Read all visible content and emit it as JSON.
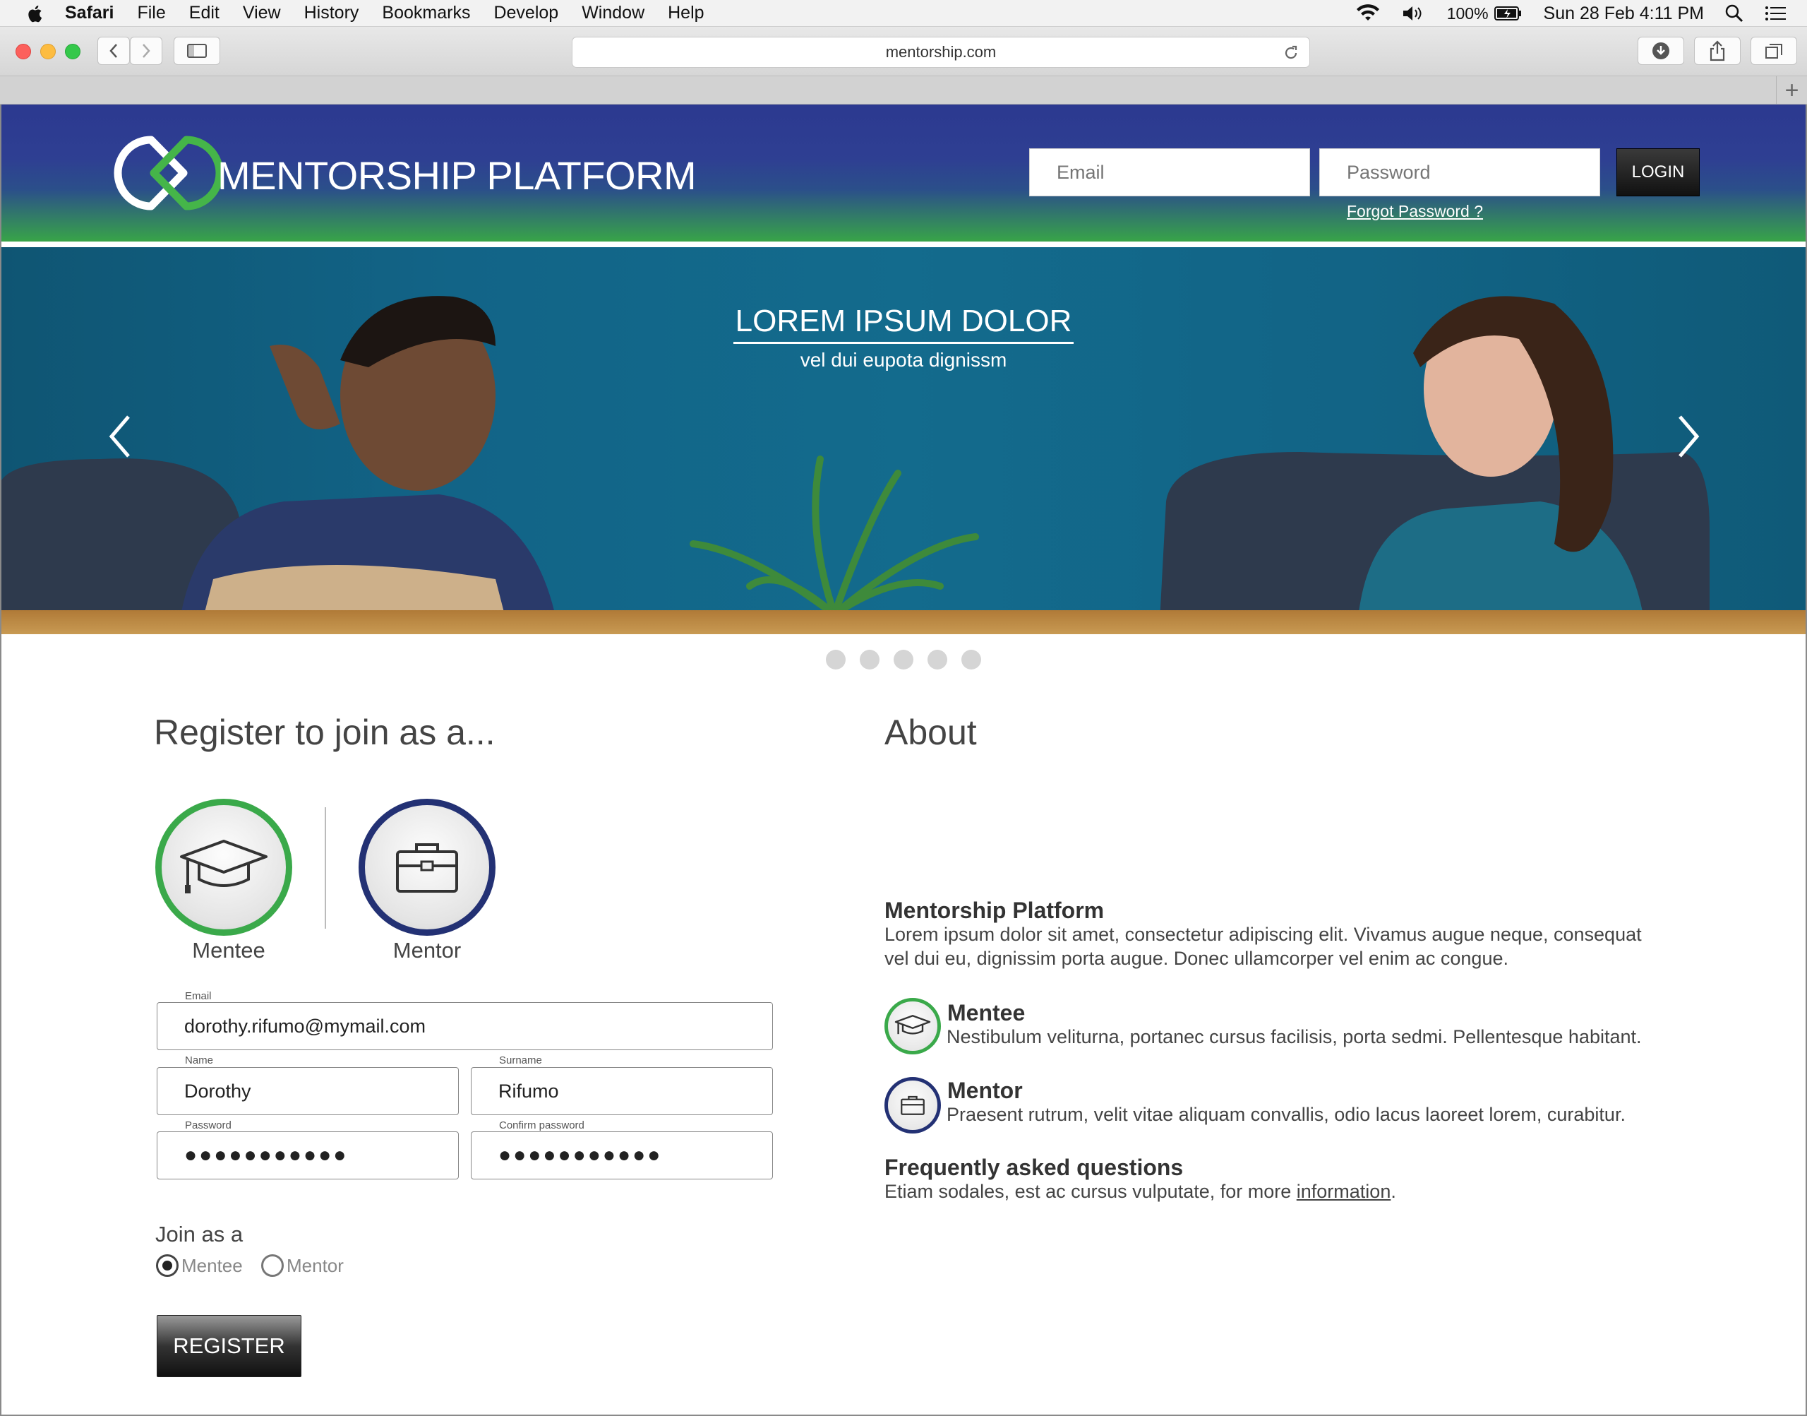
{
  "menubar": {
    "app": "Safari",
    "items": [
      "File",
      "Edit",
      "View",
      "History",
      "Bookmarks",
      "Develop",
      "Window",
      "Help"
    ],
    "battery": "100%",
    "clock": "Sun 28 Feb  4:11 PM"
  },
  "browser": {
    "url": "mentorship.com",
    "new_tab": "+"
  },
  "header": {
    "brand": "MENTORSHIP PLATFORM",
    "email_placeholder": "Email",
    "password_placeholder": "Password",
    "login_label": "LOGIN",
    "forgot_label": "Forgot Password ?"
  },
  "hero": {
    "title": "LOREM IPSUM DOLOR",
    "subtitle": "vel dui eupota dignissm",
    "slide_count": 5
  },
  "register": {
    "title": "Register to join as a...",
    "mentee_label": "Mentee",
    "mentor_label": "Mentor",
    "email_label": "Email",
    "email_value": "dorothy.rifumo@mymail.com",
    "name_label": "Name",
    "name_value": "Dorothy",
    "surname_label": "Surname",
    "surname_value": "Rifumo",
    "password_label": "Password",
    "password_value": "●●●●●●●●●●●",
    "confirm_label": "Confirm password",
    "confirm_value": "●●●●●●●●●●●",
    "join_label": "Join as a",
    "radio_mentee": "Mentee",
    "radio_mentor": "Mentor",
    "register_label": "REGISTER"
  },
  "about": {
    "title": "About",
    "platform_title": "Mentorship Platform",
    "platform_text": "Lorem ipsum dolor sit amet, consectetur adipiscing elit. Vivamus augue neque, consequat vel dui eu, dignissim porta augue. Donec ullamcorper vel enim ac congue.",
    "mentee_title": "Mentee",
    "mentee_text": "Nestibulum veliturna, portanec cursus facilisis, porta sedmi. Pellentesque habitant.",
    "mentor_title": "Mentor",
    "mentor_text": "Praesent rutrum, velit vitae aliquam convallis, odio lacus laoreet lorem, curabitur.",
    "faq_title": "Frequently asked questions",
    "faq_text": "Etiam sodales, est ac cursus vulputate, for more ",
    "faq_link": "information",
    "faq_end": "."
  },
  "colors": {
    "brand_navy": "#2c3990",
    "brand_green": "#3aa94a",
    "hero_teal": "#136b8d"
  }
}
